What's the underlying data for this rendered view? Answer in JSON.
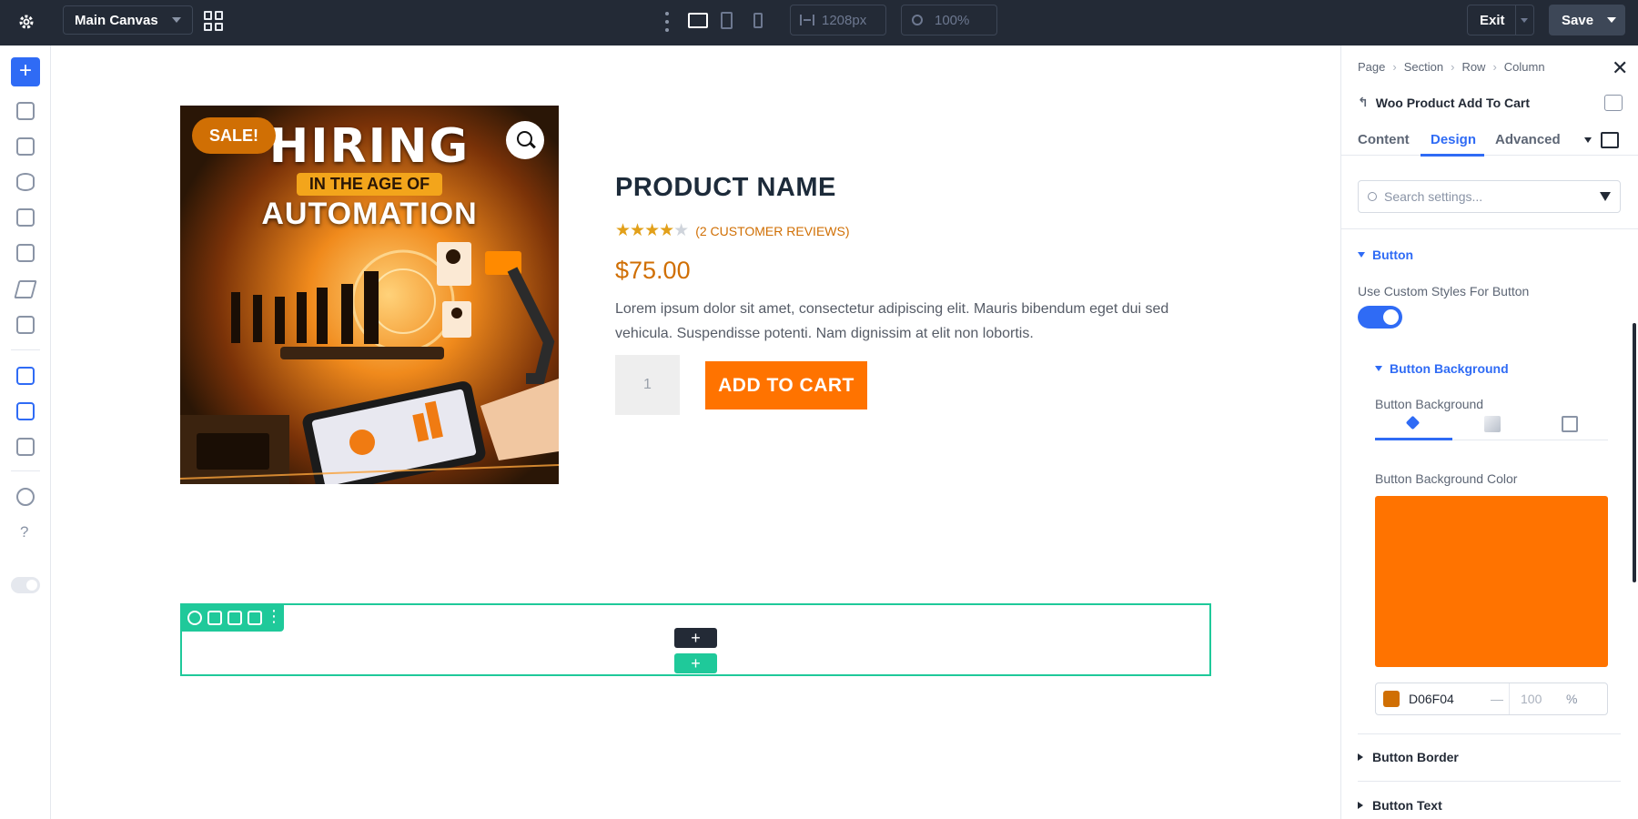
{
  "topbar": {
    "canvas_name": "Main Canvas",
    "width_value": "1208px",
    "zoom_value": "100%",
    "exit_label": "Exit",
    "save_label": "Save"
  },
  "canvas": {
    "product": {
      "image_badge": "SALE!",
      "image_title_line1": "HIRING",
      "image_title_line2": "IN THE AGE OF",
      "image_title_line3": "AUTOMATION",
      "name": "PRODUCT NAME",
      "rating_stars": 4,
      "reviews": "(2 CUSTOMER REVIEWS)",
      "price": "$75.00",
      "description": "Lorem ipsum dolor sit amet, consectetur adipiscing elit. Mauris bibendum eget dui sed vehicula. Suspendisse potenti. Nam dignissim at elit non lobortis.",
      "quantity": "1",
      "add_to_cart_label": "ADD TO CART"
    },
    "add_row_symbol": "+"
  },
  "panel": {
    "breadcrumbs": [
      "Page",
      "Section",
      "Row",
      "Column"
    ],
    "module_title": "Woo Product Add To Cart",
    "tabs": [
      "Content",
      "Design",
      "Advanced"
    ],
    "active_tab": "Design",
    "search_placeholder": "Search settings...",
    "group_button": "Button",
    "use_custom_styles_label": "Use Custom Styles For Button",
    "use_custom_styles_on": true,
    "subgroup_background": "Button Background",
    "background_label": "Button Background",
    "background_color_label": "Button Background Color",
    "background_color_hex": "D06F04",
    "background_color_display": "#ff7300",
    "opacity_value": "100",
    "opacity_unit": "%",
    "opacity_dash": "—",
    "group_border": "Button Border",
    "group_text": "Button Text"
  },
  "colors": {
    "accent": "#2f6bf5",
    "topbar_bg": "#232a36",
    "sale_orange": "#d06f04",
    "button_orange": "#ff7300",
    "section_teal": "#1fc99a"
  }
}
